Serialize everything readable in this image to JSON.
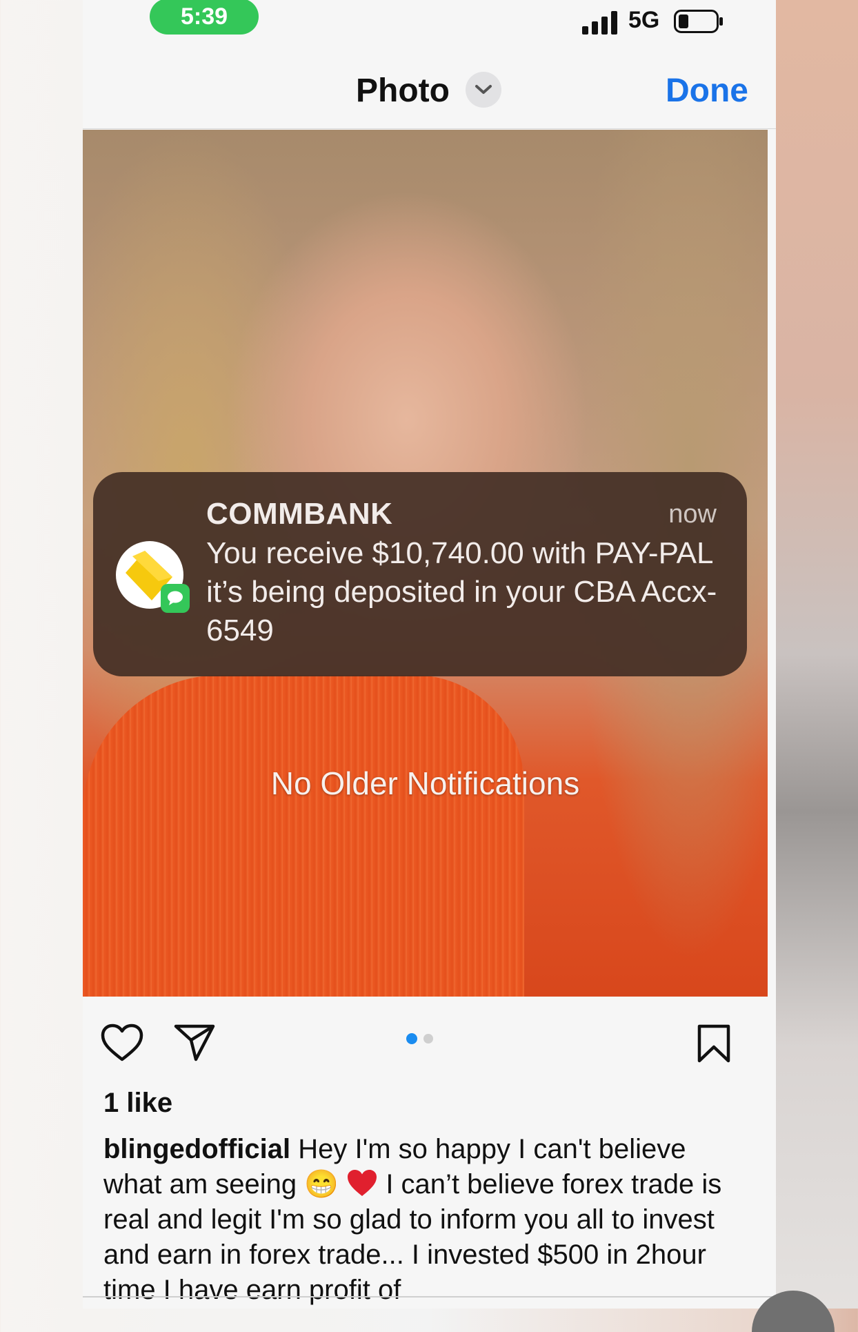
{
  "status_bar": {
    "time": "5:39",
    "network": "5G"
  },
  "nav": {
    "title": "Photo",
    "done_label": "Done"
  },
  "notification": {
    "app": "COMMBANK",
    "time": "now",
    "message": "You receive $10,740.00 with PAY-PAL it’s being deposited in your CBA  Accx- 6549"
  },
  "no_older": "No Older Notifications",
  "post": {
    "likes": "1 like",
    "username": "blingedofficial",
    "caption_before_emoji": " Hey I'm so happy I can't believe what am seeing ",
    "emoji": "😁",
    "caption_after_emoji": " I can’t believe forex trade is real and legit I'm so glad to inform you all to invest and earn in forex trade... I invested $500 in 2hour time I have earn profit of"
  },
  "carousel": {
    "total": 2,
    "active": 1
  },
  "colors": {
    "accent": "#1a73e8",
    "time_pill": "#34c759",
    "dot_active": "#1a8cf0",
    "dot_inactive": "#cfcfcf"
  }
}
